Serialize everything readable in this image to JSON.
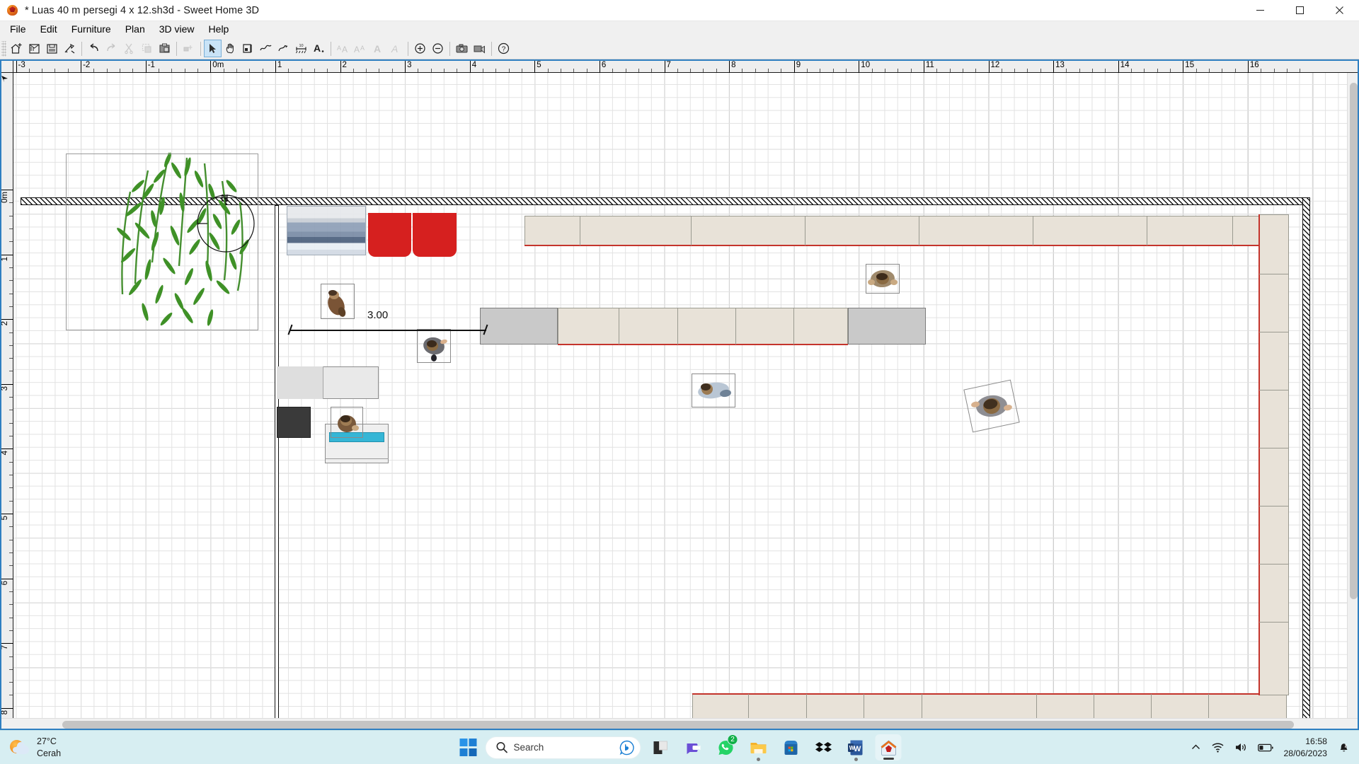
{
  "window": {
    "title": "* Luas 40 m persegi 4 x 12.sh3d - Sweet Home 3D",
    "app_icon": "sweet-home-3d-logo",
    "controls": {
      "minimize": "Minimize",
      "maximize": "Maximize",
      "close": "Close"
    }
  },
  "menubar": {
    "items": [
      {
        "label": "File"
      },
      {
        "label": "Edit"
      },
      {
        "label": "Furniture"
      },
      {
        "label": "Plan"
      },
      {
        "label": "3D view"
      },
      {
        "label": "Help"
      }
    ]
  },
  "toolbar": {
    "groups": [
      {
        "buttons": [
          {
            "name": "new-home-button",
            "icon": "new-home-icon",
            "title": "New home",
            "selected": false,
            "disabled": false
          },
          {
            "name": "open-button",
            "icon": "open-folder-icon",
            "title": "Open",
            "selected": false,
            "disabled": false
          },
          {
            "name": "save-button",
            "icon": "save-disk-icon",
            "title": "Save",
            "selected": false,
            "disabled": false
          },
          {
            "name": "preferences-button",
            "icon": "preferences-icon",
            "title": "Preferences",
            "selected": false,
            "disabled": false
          }
        ]
      },
      {
        "buttons": [
          {
            "name": "undo-button",
            "icon": "undo-arrow-icon",
            "title": "Undo",
            "selected": false,
            "disabled": false
          },
          {
            "name": "redo-button",
            "icon": "redo-arrow-icon",
            "title": "Redo",
            "selected": false,
            "disabled": true
          },
          {
            "name": "cut-button",
            "icon": "scissors-icon",
            "title": "Cut",
            "selected": false,
            "disabled": true
          },
          {
            "name": "copy-button",
            "icon": "copy-icon",
            "title": "Copy",
            "selected": false,
            "disabled": true
          },
          {
            "name": "paste-button",
            "icon": "clipboard-icon",
            "title": "Paste",
            "selected": false,
            "disabled": false
          }
        ]
      },
      {
        "buttons": [
          {
            "name": "add-furniture-button",
            "icon": "add-furniture-icon",
            "title": "Add furniture",
            "selected": false,
            "disabled": true
          }
        ]
      },
      {
        "buttons": [
          {
            "name": "select-mode-button",
            "icon": "arrow-pointer-icon",
            "title": "Select",
            "selected": true,
            "disabled": false
          },
          {
            "name": "pan-mode-button",
            "icon": "hand-pan-icon",
            "title": "Pan",
            "selected": false,
            "disabled": false
          },
          {
            "name": "create-walls-button",
            "icon": "create-walls-icon",
            "title": "Create walls",
            "selected": false,
            "disabled": false
          },
          {
            "name": "create-rooms-button",
            "icon": "create-rooms-icon",
            "title": "Create rooms",
            "selected": false,
            "disabled": false
          },
          {
            "name": "create-polyline-button",
            "icon": "create-polyline-icon",
            "title": "Create polylines",
            "selected": false,
            "disabled": false
          },
          {
            "name": "create-dimensions-button",
            "icon": "create-dimensions-icon",
            "title": "Create dimensions",
            "selected": false,
            "disabled": false
          },
          {
            "name": "add-text-button",
            "icon": "add-text-icon",
            "title": "Add texts",
            "selected": false,
            "disabled": false
          }
        ]
      },
      {
        "buttons": [
          {
            "name": "increase-text-size-button",
            "icon": "increase-text-size-icon",
            "title": "Increase text size",
            "selected": false,
            "disabled": true
          },
          {
            "name": "decrease-text-size-button",
            "icon": "decrease-text-size-icon",
            "title": "Decrease text size",
            "selected": false,
            "disabled": true
          },
          {
            "name": "bold-style-button",
            "icon": "bold-text-icon",
            "title": "Toggle bold style",
            "selected": false,
            "disabled": true
          },
          {
            "name": "italic-style-button",
            "icon": "italic-text-icon",
            "title": "Toggle italic style",
            "selected": false,
            "disabled": true
          }
        ]
      },
      {
        "buttons": [
          {
            "name": "zoom-in-button",
            "icon": "zoom-in-icon",
            "title": "Zoom in",
            "selected": false,
            "disabled": false
          },
          {
            "name": "zoom-out-button",
            "icon": "zoom-out-icon",
            "title": "Zoom out",
            "selected": false,
            "disabled": false
          }
        ]
      },
      {
        "buttons": [
          {
            "name": "create-photo-button",
            "icon": "photo-camera-icon",
            "title": "Create photo",
            "selected": false,
            "disabled": false
          },
          {
            "name": "create-video-button",
            "icon": "video-camera-icon",
            "title": "Create video",
            "selected": false,
            "disabled": false
          }
        ]
      },
      {
        "buttons": [
          {
            "name": "help-button",
            "icon": "help-question-icon",
            "title": "Help",
            "selected": false,
            "disabled": false
          }
        ]
      }
    ]
  },
  "plan": {
    "horizontal_ruler": {
      "unit_label": "0m",
      "labels": [
        "-3",
        "-2",
        "-1",
        "0m",
        "1",
        "2",
        "3",
        "4",
        "5",
        "6",
        "7",
        "8",
        "9",
        "10",
        "11",
        "12",
        "13",
        "14",
        "15",
        "16"
      ]
    },
    "vertical_ruler": {
      "labels": [
        "0m",
        "1",
        "2",
        "3",
        "4",
        "5",
        "6",
        "7",
        "8"
      ]
    },
    "dimension": {
      "value": "3.00"
    },
    "compass": {
      "label": "N"
    },
    "objects": [
      {
        "name": "bamboo-plant",
        "type": "plant"
      },
      {
        "name": "window-blue",
        "type": "window"
      },
      {
        "name": "red-sofa-left",
        "type": "sofa"
      },
      {
        "name": "red-sofa-right",
        "type": "sofa"
      },
      {
        "name": "person-standing-1",
        "type": "person"
      },
      {
        "name": "person-standing-2",
        "type": "person"
      },
      {
        "name": "person-lying",
        "type": "person"
      },
      {
        "name": "person-sitting",
        "type": "person"
      },
      {
        "name": "person-seated-chair",
        "type": "person"
      },
      {
        "name": "person-top-right",
        "type": "person"
      },
      {
        "name": "kitchen-counter",
        "type": "counter"
      },
      {
        "name": "fridge",
        "type": "appliance"
      },
      {
        "name": "sink-unit",
        "type": "sink"
      },
      {
        "name": "cabinet-row-top",
        "type": "cabinet-row"
      },
      {
        "name": "cabinet-row-middle",
        "type": "cabinet-row"
      },
      {
        "name": "cabinet-row-bottom",
        "type": "cabinet-row"
      },
      {
        "name": "cabinet-column-right",
        "type": "cabinet-column"
      }
    ]
  },
  "taskbar": {
    "weather": {
      "temperature": "27°C",
      "condition": "Cerah",
      "icon": "sun-cloud-icon"
    },
    "start": {
      "name": "start-button",
      "icon": "windows-logo-icon"
    },
    "search": {
      "placeholder": "Search",
      "icon": "search-icon",
      "bing_icon": "bing-chat-icon"
    },
    "apps": [
      {
        "name": "task-view-button",
        "icon": "task-view-icon",
        "running": false,
        "badge": null
      },
      {
        "name": "teams-button",
        "icon": "teams-icon",
        "running": false,
        "badge": null
      },
      {
        "name": "whatsapp-button",
        "icon": "whatsapp-icon",
        "running": false,
        "badge": "2"
      },
      {
        "name": "file-explorer-button",
        "icon": "folder-icon",
        "running": true,
        "badge": null
      },
      {
        "name": "microsoft-store-button",
        "icon": "store-icon",
        "running": false,
        "badge": null
      },
      {
        "name": "dropbox-button",
        "icon": "dropbox-icon",
        "running": false,
        "badge": null
      },
      {
        "name": "word-button",
        "icon": "word-icon",
        "running": true,
        "badge": null
      },
      {
        "name": "sweet-home-3d-button",
        "icon": "sweet-home-3d-icon",
        "running": true,
        "badge": null,
        "active": true
      }
    ],
    "tray": {
      "overflow_icon": "chevron-up-icon",
      "wifi_icon": "wifi-icon",
      "volume_icon": "speaker-icon",
      "battery_icon": "battery-icon",
      "time": "16:58",
      "date": "28/06/2023",
      "notification_icon": "bell-quiet-icon"
    }
  },
  "colors": {
    "accent": "#2f7fc1",
    "selection": "#c9e3f7",
    "taskbar_bg": "#d7eef2",
    "wall": "#111111",
    "furniture_beige": "#e8e2d8",
    "furniture_red": "#d6201f",
    "plant_green": "#3c8a25"
  }
}
